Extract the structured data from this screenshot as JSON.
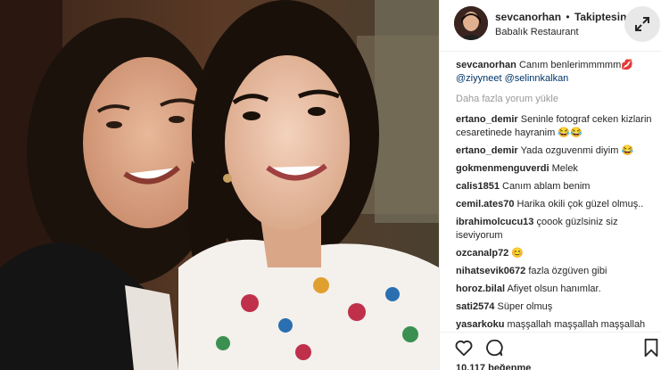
{
  "post": {
    "username": "sevcanorhan",
    "separator": "•",
    "follow_status": "Takiptesin",
    "location": "Babalık Restaurant"
  },
  "caption": {
    "username": "sevcanorhan",
    "text": "Canım benlerimmmmm",
    "emoji": "💋",
    "mention1": "@ziyyneet",
    "mention2": "@selinnkalkan"
  },
  "load_more": "Daha fazla yorum yükle",
  "comments": [
    {
      "user": "ertano_demir",
      "text": "Seninle fotograf ceken kizlarin cesaretinede hayranim 😂😂"
    },
    {
      "user": "ertano_demir",
      "text": "Yada ozguvenmi diyim 😂"
    },
    {
      "user": "gokmenmenguverdi",
      "text": "Melek"
    },
    {
      "user": "calis1851",
      "text": "Canım ablam benim"
    },
    {
      "user": "cemil.ates70",
      "text": "Harika okili çok güzel olmuş.."
    },
    {
      "user": "ibrahimolcucu13",
      "text": "çoook güzlsiniz siz iseviyorum"
    },
    {
      "user": "ozcanalp72",
      "text": "😊"
    },
    {
      "user": "nihatsevik0672",
      "text": "fazla özgüven gibi"
    },
    {
      "user": "horoz.bilal",
      "text": "Afiyet olsun hanımlar."
    },
    {
      "user": "sati2574",
      "text": "Süper olmuş"
    },
    {
      "user": "yasarkoku",
      "text": "maşşallah maşşallah maşşallah"
    }
  ],
  "likes_text": "10.117 beğenme",
  "icons": {
    "like": "heart-icon",
    "comment": "comment-icon",
    "save": "bookmark-icon",
    "expand": "expand-arrows-icon"
  },
  "colors": {
    "link": "#003569",
    "muted": "#999999",
    "text": "#262626"
  }
}
